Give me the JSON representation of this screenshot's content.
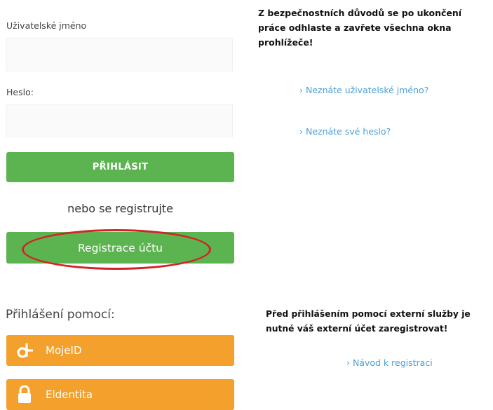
{
  "login": {
    "username_label": "Uživatelské jméno",
    "username_value": "",
    "password_label": "Heslo:",
    "password_value": "",
    "submit_label": "PŘIHLÁSIT",
    "or_register": "nebo se registrujte",
    "register_label": "Registrace účtu"
  },
  "security_notice": "Z bezpečnostních důvodů se po ukončení práce odhlaste a zavřete všechna okna prohlížeče!",
  "help_links": {
    "forgot_username": "› Neznáte uživatelské jméno?",
    "forgot_password": "› Neznáte své heslo?"
  },
  "external": {
    "heading": "Přihlášení pomocí:",
    "notice": "Před přihlášením pomocí externí služby je nutné váš externí účet zaregistrovat!",
    "guide_link": "› Návod k registraci",
    "providers": [
      {
        "label": "MojeID",
        "icon": "mojeid-icon"
      },
      {
        "label": "Eldentita",
        "icon": "lock-icon"
      }
    ]
  },
  "colors": {
    "primary_green": "#5cb450",
    "provider_orange": "#f3a02c",
    "link_blue": "#4a9fd8",
    "highlight_red": "#d32228"
  }
}
